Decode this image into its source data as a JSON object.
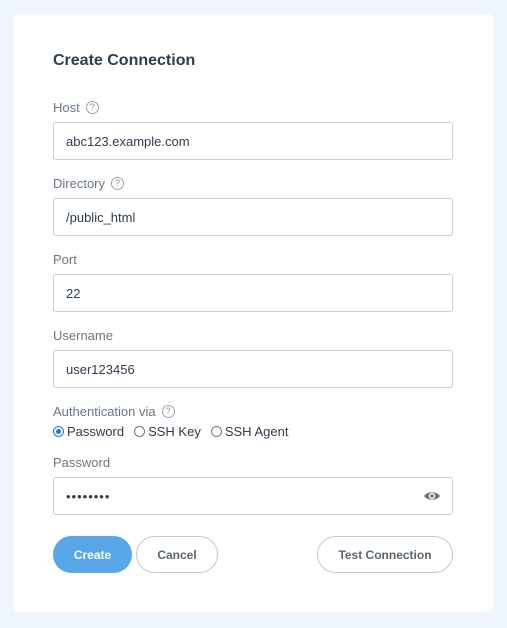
{
  "form": {
    "title": "Create Connection",
    "host": {
      "label": "Host",
      "value": "abc123.example.com"
    },
    "directory": {
      "label": "Directory",
      "value": "/public_html"
    },
    "port": {
      "label": "Port",
      "value": "22"
    },
    "username": {
      "label": "Username",
      "value": "user123456"
    },
    "auth": {
      "label": "Authentication via",
      "options": [
        "Password",
        "SSH Key",
        "SSH Agent"
      ],
      "selected": "Password"
    },
    "password": {
      "label": "Password",
      "value": "••••••••"
    },
    "help_glyph": "?"
  },
  "buttons": {
    "create": "Create",
    "cancel": "Cancel",
    "test": "Test Connection"
  },
  "colors": {
    "primary": "#59a7e8",
    "background": "#eef5fd",
    "radio_selected": "#1a73e8"
  },
  "icons": {
    "help": "help-circle-icon",
    "password_visibility": "eye-icon"
  }
}
